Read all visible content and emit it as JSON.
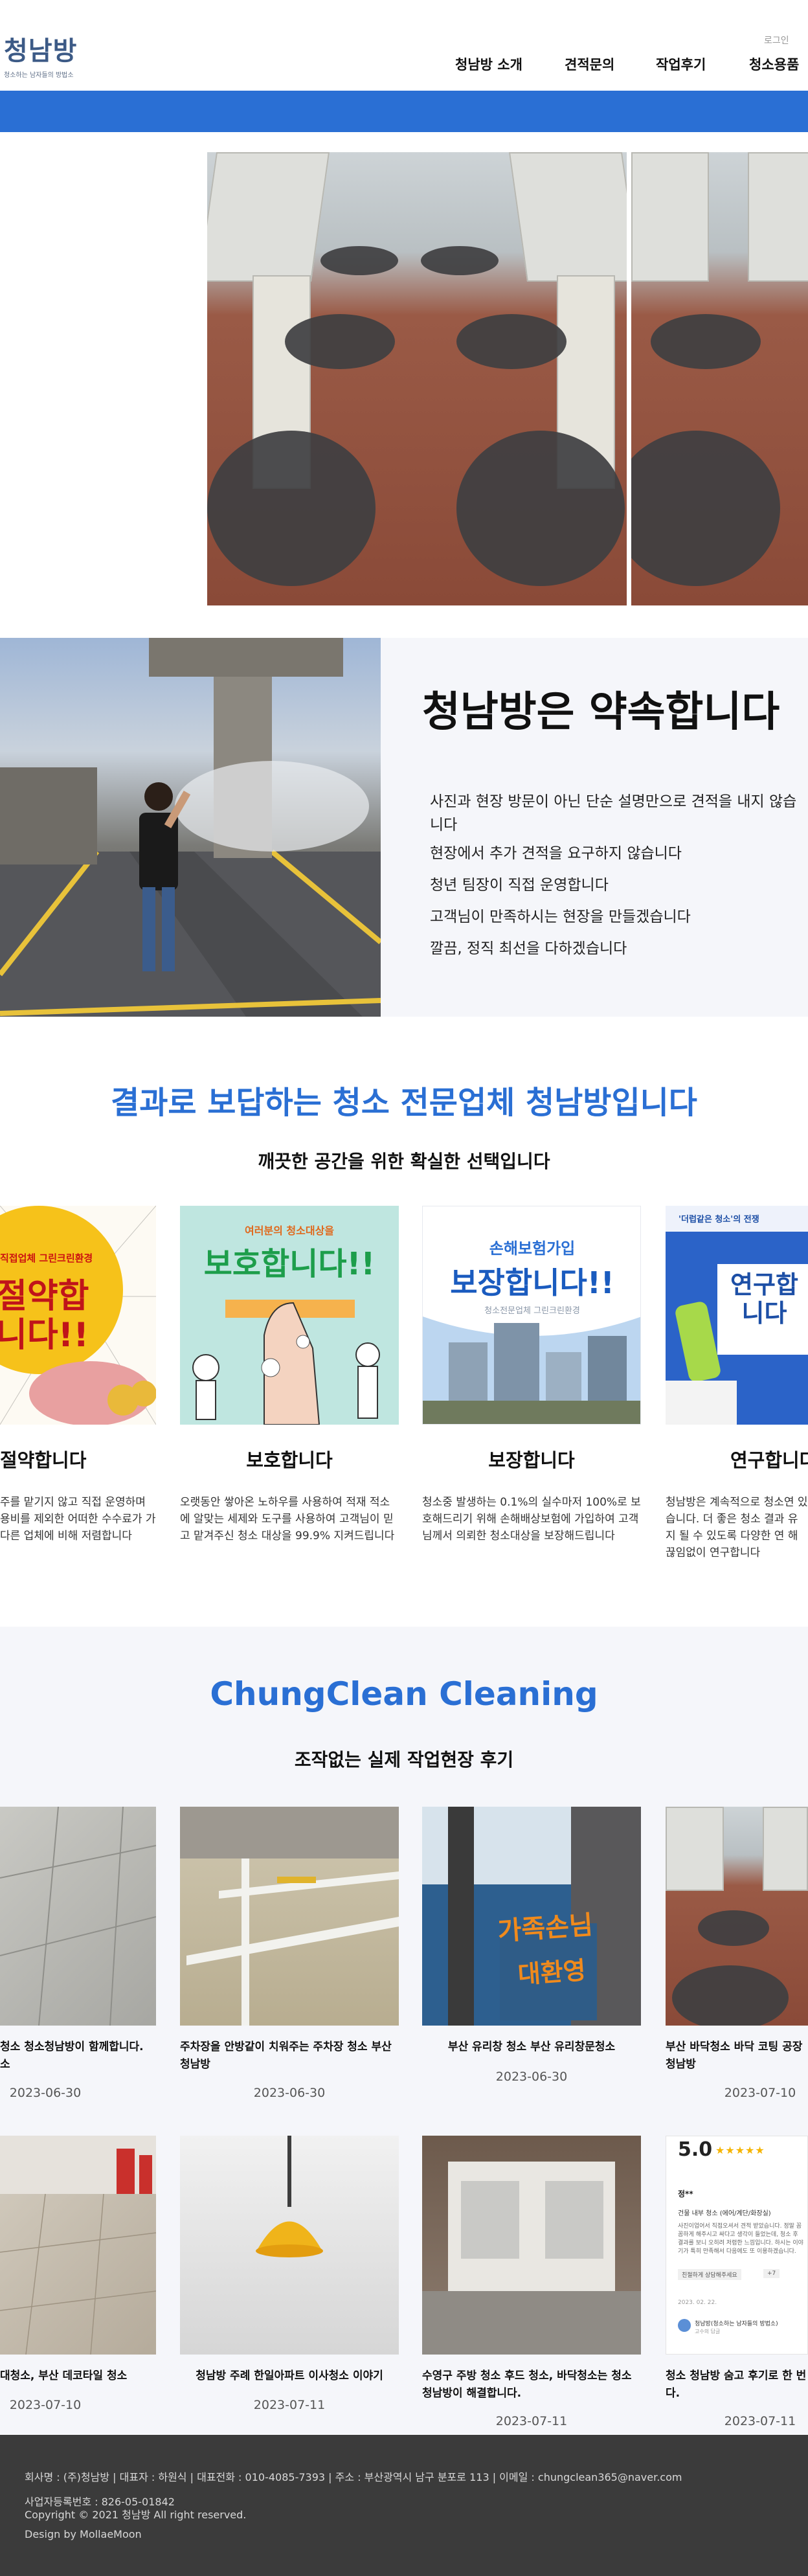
{
  "header": {
    "logo_text": "청남방",
    "logo_tagline": "청소하는 남자들의 방법소",
    "login": "로그인",
    "nav": [
      "청남방 소개",
      "견적문의",
      "작업후기",
      "청소용품"
    ]
  },
  "promise": {
    "title": "청남방은 약속합니다",
    "lines": [
      "사진과 현장 방문이 아닌 단순 설명만으로 견적을 내지 않습니다",
      "현장에서 추가 견적을 요구하지 않습니다",
      "청년 팀장이 직접 운영합니다",
      "고객님이 만족하시는 현장을 만들겠습니다",
      "깔끔, 정직 최선을 다하겠습니다"
    ]
  },
  "features": {
    "title": "결과로 보답하는 청소 전문업체 청남방입니다",
    "subtitle": "깨끗한 공간을 위한 확실한 선택입니다",
    "cards": [
      {
        "img_small": "직접업체 그린크린환경",
        "img_big": "절약합니다!!",
        "title": "절약합니다",
        "desc": "주를 맡기지 않고 직접 운영하며 용비를 제외한 어떠한 수수료가 가 다른 업체에 비해 저렴합니다"
      },
      {
        "img_small": "여러분의 청소대상을",
        "img_big": "보호합니다!!",
        "title": "보호합니다",
        "desc": "오랫동안 쌓아온 노하우를 사용하여 적재 적소에 알맞는 세제와 도구를 사용하여 고객님이 믿고 맡겨주신 청소 대상을 99.9% 지켜드립니다"
      },
      {
        "img_small": "손해보험가입",
        "img_big": "보장합니다!!",
        "img_caption": "청소전문업체 그린크린환경",
        "title": "보장합니다",
        "desc": "청소중 발생하는 0.1%의 실수마저 100%로 보호해드리기 위해 손해배상보험에 가입하여 고객님께서 의뢰한 청소대상을 보장해드립니다"
      },
      {
        "img_small": "'더럽같은 청소'의 전쟁",
        "img_big": "연구합니다",
        "title": "연구합니다",
        "desc": "청남방은 계속적으로 청소연 있습니다. 더 좋은 청소 결과 유지 될 수 있도록 다양한 연 해 끊임없이 연구합니다"
      }
    ]
  },
  "reviews": {
    "title": "ChungClean Cleaning",
    "subtitle": "조작없는 실제 작업현장 후기",
    "row1": [
      {
        "caption": "청소 청소청남방이 함께합니다. 소",
        "date": "2023-06-30"
      },
      {
        "caption": "주차장을 안방같이 치워주는 주차장 청소 부산 청남방",
        "date": "2023-06-30"
      },
      {
        "caption": "부산 유리창 청소 부산 유리창문청소",
        "date": "2023-06-30",
        "sign1": "가족손님",
        "sign2": "대환영"
      },
      {
        "caption": "부산 바닥청소 바닥 코팅 공장 청남방",
        "date": "2023-07-10"
      }
    ],
    "row2": [
      {
        "caption": "대청소, 부산 데코타일 청소",
        "date": "2023-07-10"
      },
      {
        "caption": "청남방 주례 한일아파트 이사청소 이야기",
        "date": "2023-07-11"
      },
      {
        "caption": "수영구 주방 청소 후드 청소, 바닥청소는 청소 청남방이 해결합니다.",
        "date": "2023-07-11"
      },
      {
        "caption": "청소 청남방 숨고 후기로 한 번 다.",
        "date": "2023-07-11",
        "rating": "5.0",
        "review_name": "정**",
        "review_tag": "건물 내부 청소 (에어/계단/화장실)",
        "review_text": "사진이업어서 직접오셔서 견적 받았습니다. 정말 꼼꼼하게 해주시고 싸다고 생각이 들었는데, 청소 후 결과를 보니 오히려 저렴한 느낌입니다. 하시는 이야기가 특히 만족해서 다음에도 또 이용하겠습니다.",
        "review_chip": "친절하게 상담해주세요",
        "review_more": "+7",
        "review_date": "2023. 02. 22.",
        "review_reply": "청남방(청소하는 남자들의 방법소)",
        "review_reply_sub": "고수의 답글"
      }
    ]
  },
  "footer": {
    "line1": "회사명 : (주)청남방 | 대표자 : 하원식 | 대표전화 : 010-4085-7393 | 주소 : 부산광역시 남구 분포로 113 | 이메일 : chungclean365@naver.com",
    "line2": "사업자등록번호 : 826-05-01842",
    "line3": "Copyright © 2021 청남방 All right reserved.",
    "line4": "Design by MollaeMoon"
  },
  "colors": {
    "accent": "#2a6fd4",
    "logo": "#3c5a86",
    "footer": "#3b3b3b",
    "section_bg": "#f5f6fa"
  }
}
